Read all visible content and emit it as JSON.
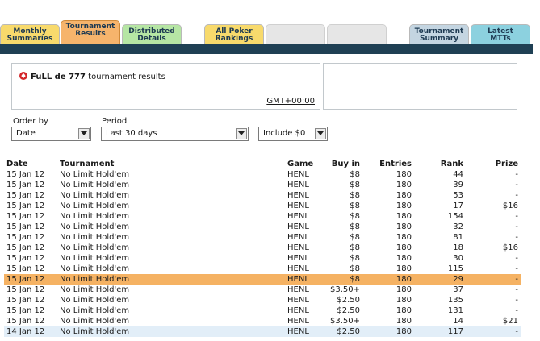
{
  "tabs": [
    {
      "label1": "Monthly",
      "label2": "Summaries"
    },
    {
      "label1": "Tournament",
      "label2": "Results"
    },
    {
      "label1": "Distributed",
      "label2": "Details"
    },
    {
      "label1": "All Poker",
      "label2": "Rankings"
    },
    {
      "label1": "Tournament",
      "label2": "Summary"
    },
    {
      "label1": "Latest",
      "label2": "MTTs"
    }
  ],
  "info": {
    "player": "FuLL de 777",
    "title_suffix": "tournament results",
    "timezone": "GMT+00:00"
  },
  "filters": {
    "order_label": "Order by",
    "order_value": "Date",
    "period_label": "Period",
    "period_value": "Last 30 days",
    "include_value": "Include $0"
  },
  "colors": {
    "tab_dark_bar": "#1f4054",
    "highlight_row": "#f5b263"
  },
  "table": {
    "headers": {
      "date": "Date",
      "tournament": "Tournament",
      "game": "Game",
      "buyin": "Buy in",
      "entries": "Entries",
      "rank": "Rank",
      "prize": "Prize"
    },
    "rows": [
      {
        "date": "15 Jan 12",
        "tournament": "No Limit Hold'em",
        "game": "HENL",
        "buyin": "$8",
        "entries": "180",
        "rank": "44",
        "prize": "-"
      },
      {
        "date": "15 Jan 12",
        "tournament": "No Limit Hold'em",
        "game": "HENL",
        "buyin": "$8",
        "entries": "180",
        "rank": "39",
        "prize": "-"
      },
      {
        "date": "15 Jan 12",
        "tournament": "No Limit Hold'em",
        "game": "HENL",
        "buyin": "$8",
        "entries": "180",
        "rank": "53",
        "prize": "-"
      },
      {
        "date": "15 Jan 12",
        "tournament": "No Limit Hold'em",
        "game": "HENL",
        "buyin": "$8",
        "entries": "180",
        "rank": "17",
        "prize": "$16"
      },
      {
        "date": "15 Jan 12",
        "tournament": "No Limit Hold'em",
        "game": "HENL",
        "buyin": "$8",
        "entries": "180",
        "rank": "154",
        "prize": "-"
      },
      {
        "date": "15 Jan 12",
        "tournament": "No Limit Hold'em",
        "game": "HENL",
        "buyin": "$8",
        "entries": "180",
        "rank": "32",
        "prize": "-"
      },
      {
        "date": "15 Jan 12",
        "tournament": "No Limit Hold'em",
        "game": "HENL",
        "buyin": "$8",
        "entries": "180",
        "rank": "81",
        "prize": "-"
      },
      {
        "date": "15 Jan 12",
        "tournament": "No Limit Hold'em",
        "game": "HENL",
        "buyin": "$8",
        "entries": "180",
        "rank": "18",
        "prize": "$16"
      },
      {
        "date": "15 Jan 12",
        "tournament": "No Limit Hold'em",
        "game": "HENL",
        "buyin": "$8",
        "entries": "180",
        "rank": "30",
        "prize": "-"
      },
      {
        "date": "15 Jan 12",
        "tournament": "No Limit Hold'em",
        "game": "HENL",
        "buyin": "$8",
        "entries": "180",
        "rank": "115",
        "prize": "-"
      },
      {
        "date": "15 Jan 12",
        "tournament": "No Limit Hold'em",
        "game": "HENL",
        "buyin": "$8",
        "entries": "180",
        "rank": "29",
        "prize": "-"
      },
      {
        "date": "15 Jan 12",
        "tournament": "No Limit Hold'em",
        "game": "HENL",
        "buyin": "$3.50+",
        "entries": "180",
        "rank": "37",
        "prize": "-"
      },
      {
        "date": "15 Jan 12",
        "tournament": "No Limit Hold'em",
        "game": "HENL",
        "buyin": "$2.50",
        "entries": "180",
        "rank": "135",
        "prize": "-"
      },
      {
        "date": "15 Jan 12",
        "tournament": "No Limit Hold'em",
        "game": "HENL",
        "buyin": "$2.50",
        "entries": "180",
        "rank": "131",
        "prize": "-"
      },
      {
        "date": "15 Jan 12",
        "tournament": "No Limit Hold'em",
        "game": "HENL",
        "buyin": "$3.50+",
        "entries": "180",
        "rank": "14",
        "prize": "$21"
      },
      {
        "date": "14 Jan 12",
        "tournament": "No Limit Hold'em",
        "game": "HENL",
        "buyin": "$2.50",
        "entries": "180",
        "rank": "117",
        "prize": "-"
      }
    ]
  }
}
